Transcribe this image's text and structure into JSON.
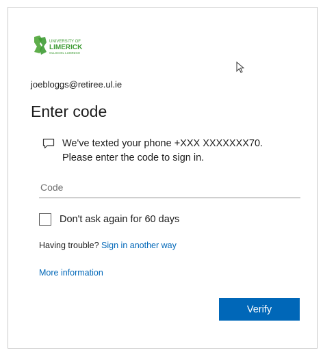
{
  "logo": {
    "line1": "UNIVERSITY OF",
    "line2": "LIMERICK",
    "line3": "OLLSCOIL LUIMNIGH",
    "color": "#3f9c35"
  },
  "account": {
    "email": "joebloggs@retiree.ul.ie"
  },
  "title": "Enter code",
  "message": {
    "icon": "message-icon",
    "line1": "We've texted your phone +XXX XXXXXXX70.",
    "line2": "Please enter the code to sign in."
  },
  "code_input": {
    "placeholder": "Code",
    "value": ""
  },
  "remember": {
    "label": "Don't ask again for 60 days",
    "checked": false
  },
  "trouble": {
    "prefix": "Having trouble?",
    "link": "Sign in another way"
  },
  "more_info": "More information",
  "verify_label": "Verify",
  "colors": {
    "accent": "#0067b8",
    "border": "#c8c8c8"
  }
}
